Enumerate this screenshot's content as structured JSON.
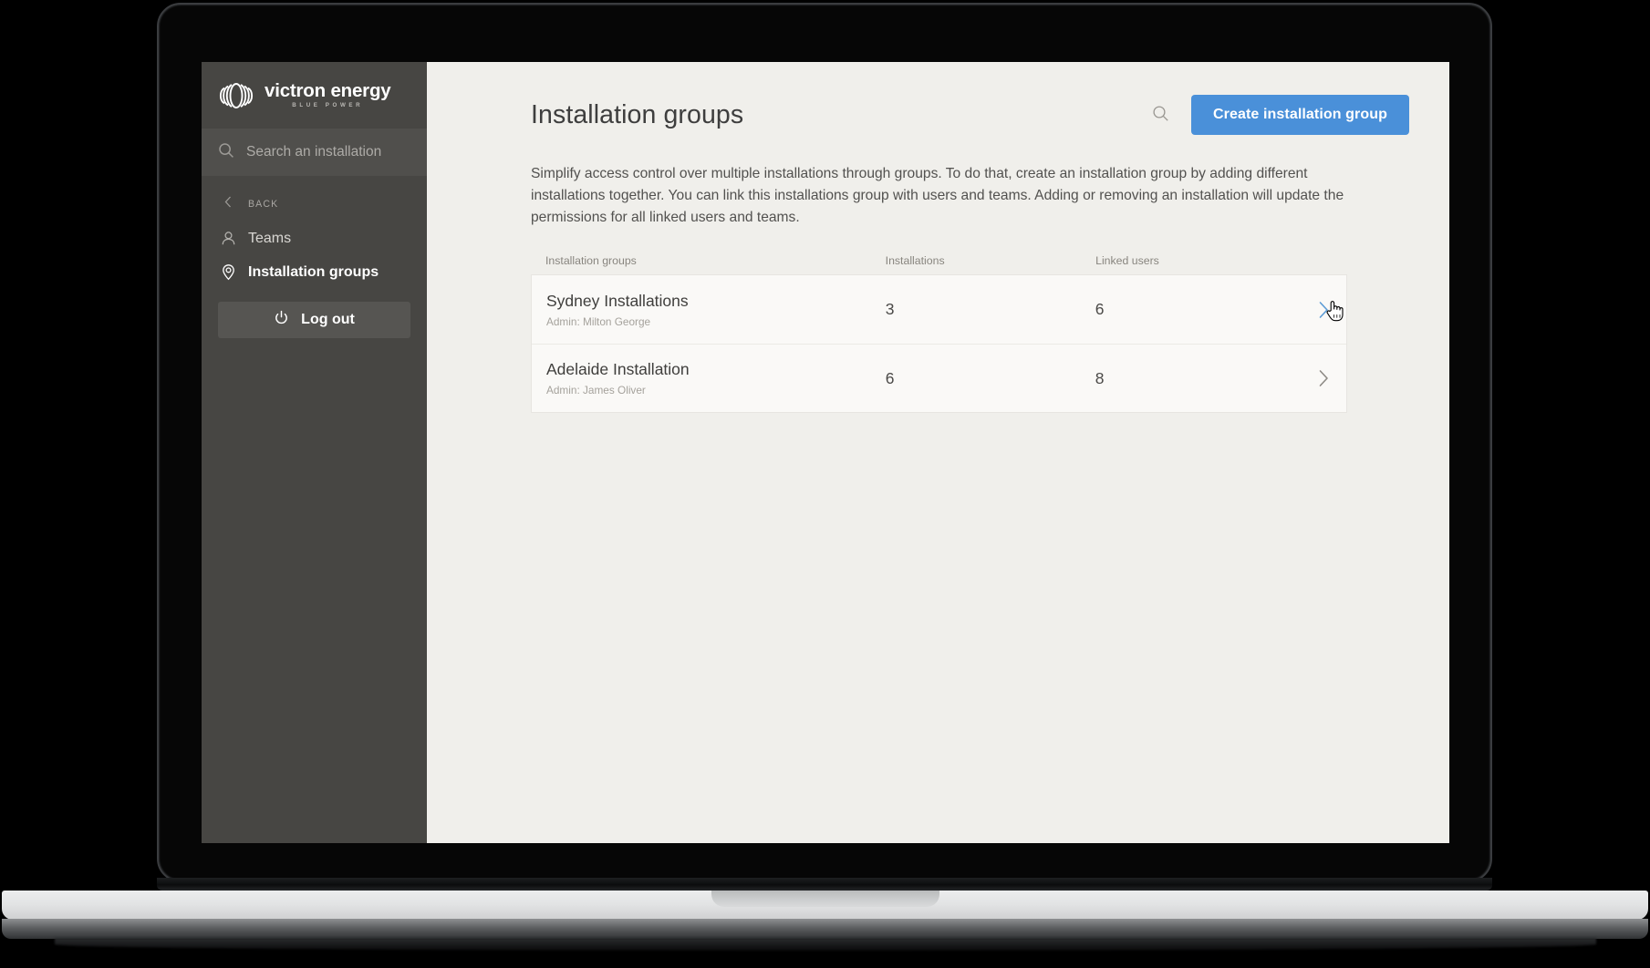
{
  "sidebar": {
    "logo": {
      "icon": "victron-logo-icon",
      "word": "victron energy",
      "tagline": "BLUE POWER"
    },
    "search": {
      "icon": "search-icon",
      "placeholder": "Search an installation",
      "value": ""
    },
    "back": {
      "icon": "chevron-left-icon",
      "label": "BACK"
    },
    "items": [
      {
        "icon": "users-icon",
        "label": "Teams",
        "active": false
      },
      {
        "icon": "map-pin-icon",
        "label": "Installation groups",
        "active": true
      }
    ],
    "logout": {
      "icon": "power-icon",
      "label": "Log out"
    }
  },
  "main": {
    "title": "Installation groups",
    "search_icon": "search-icon",
    "create_button": "Create installation group",
    "intro": "Simplify access control over multiple installations through groups. To do that, create an installation group by adding different installations together. You can link this installations group with users and teams. Adding or removing an installation will update the permissions for all linked users and teams.",
    "table": {
      "headers": {
        "name": "Installation groups",
        "installations": "Installations",
        "linked_users": "Linked users"
      },
      "rows": [
        {
          "name": "Sydney Installations",
          "admin": "Admin: Milton George",
          "installations": "3",
          "linked_users": "6",
          "arrow_icon": "chevron-right-icon",
          "hovered": true
        },
        {
          "name": "Adelaide Installation",
          "admin": "Admin: James Oliver",
          "installations": "6",
          "linked_users": "8",
          "arrow_icon": "chevron-right-icon",
          "hovered": false
        }
      ]
    }
  },
  "colors": {
    "accent": "#4a90d9",
    "hover_chevron": "#5b9bd5",
    "sidebar_bg": "#474643",
    "canvas_bg": "#f0efeb",
    "row_bg": "#faf9f7"
  }
}
